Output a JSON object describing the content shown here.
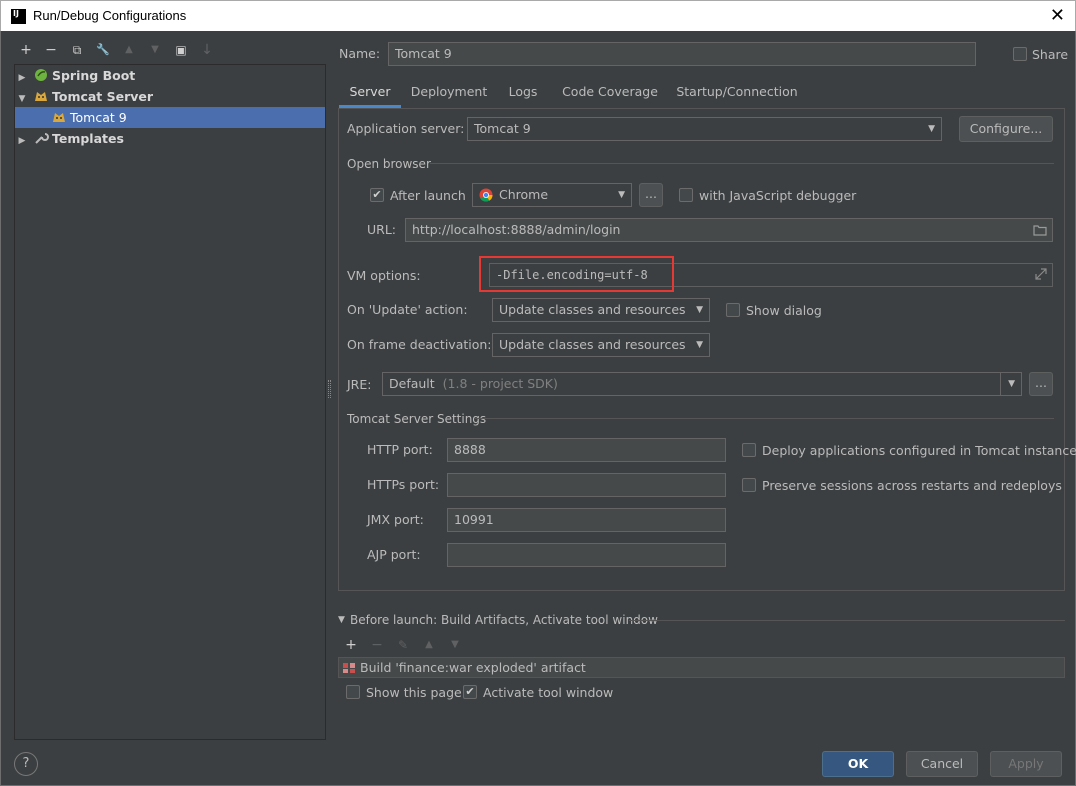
{
  "window": {
    "title": "Run/Debug Configurations",
    "close_glyph": "✕"
  },
  "toolbar": {
    "items": [
      "add-icon",
      "remove-icon",
      "copy-icon",
      "wrench-icon",
      "move-up-icon",
      "move-down-icon",
      "folder-icon",
      "sort-icon"
    ],
    "glyphs": [
      "+",
      "−",
      "⧉",
      "🔧",
      "▲",
      "▼",
      "▣",
      "↓"
    ]
  },
  "tree": {
    "items": [
      {
        "label": "Spring Boot",
        "toggle": "▶"
      },
      {
        "label": "Tomcat Server",
        "toggle": "▼"
      },
      {
        "label": "Tomcat 9",
        "toggle": ""
      },
      {
        "label": "Templates",
        "toggle": "▶"
      }
    ]
  },
  "name": {
    "label": "Name:",
    "value": "Tomcat 9"
  },
  "share": {
    "label": "Share"
  },
  "tabs": [
    "Server",
    "Deployment",
    "Logs",
    "Code Coverage",
    "Startup/Connection"
  ],
  "server": {
    "app_server_label": "Application server:",
    "app_server_value": "Tomcat 9",
    "configure_label": "Configure...",
    "open_browser_title": "Open browser",
    "after_launch_label": "After launch",
    "browser_value": "Chrome",
    "ellipsis": "...",
    "js_debugger_label": "with JavaScript debugger",
    "url_label": "URL:",
    "url_value": "http://localhost:8888/admin/login",
    "vm_options_label": "VM options:",
    "vm_options_value": "-Dfile.encoding=utf-8",
    "on_update_label": "On 'Update' action:",
    "on_update_value": "Update classes and resources",
    "show_dialog_label": "Show dialog",
    "on_frame_label": "On frame deactivation:",
    "on_frame_value": "Update classes and resources",
    "jre_label": "JRE:",
    "jre_value": "Default",
    "jre_hint": "(1.8 - project SDK)",
    "tomcat_settings_title": "Tomcat Server Settings",
    "http_port_label": "HTTP port:",
    "http_port_value": "8888",
    "https_port_label": "HTTPs port:",
    "https_port_value": "",
    "jmx_port_label": "JMX port:",
    "jmx_port_value": "10991",
    "ajp_port_label": "AJP port:",
    "ajp_port_value": "",
    "deploy_label": "Deploy applications configured in Tomcat instance",
    "preserve_label": "Preserve sessions across restarts and redeploys"
  },
  "before_launch": {
    "title": "Before launch: Build Artifacts, Activate tool window",
    "item": "Build 'finance:war exploded' artifact",
    "show_page_label": "Show this page",
    "activate_label": "Activate tool window"
  },
  "buttons": {
    "ok": "OK",
    "cancel": "Cancel",
    "apply": "Apply",
    "help": "?"
  },
  "colors": {
    "selection": "#4b6eaf",
    "highlight_box": "#e53935",
    "tab_underline": "#4a88c7"
  }
}
